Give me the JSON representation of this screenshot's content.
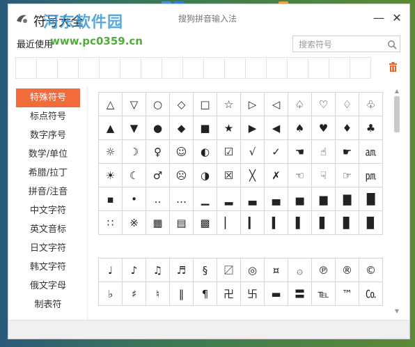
{
  "window": {
    "title": "符号大全",
    "center_title": "搜狗拼音输入法",
    "minimize_label": "—",
    "close_label": "✕"
  },
  "watermark": {
    "text": "河东软件园",
    "url": "www.pc0359.cn"
  },
  "recent": {
    "label": "最近使用",
    "cells": 17
  },
  "search": {
    "placeholder": "搜索符号",
    "value": ""
  },
  "sidebar": {
    "items": [
      {
        "label": "特殊符号",
        "active": true
      },
      {
        "label": "标点符号",
        "active": false
      },
      {
        "label": "数字序号",
        "active": false
      },
      {
        "label": "数学/单位",
        "active": false
      },
      {
        "label": "希腊/拉丁",
        "active": false
      },
      {
        "label": "拼音/注音",
        "active": false
      },
      {
        "label": "中文字符",
        "active": false
      },
      {
        "label": "英文音标",
        "active": false
      },
      {
        "label": "日文字符",
        "active": false
      },
      {
        "label": "韩文字符",
        "active": false
      },
      {
        "label": "俄文字母",
        "active": false
      },
      {
        "label": "制表符",
        "active": false
      }
    ]
  },
  "symbols_group1": [
    [
      "△",
      "▽",
      "○",
      "◇",
      "□",
      "☆",
      "▷",
      "◁",
      "♤",
      "♡",
      "♢",
      "♧"
    ],
    [
      "▲",
      "▼",
      "●",
      "◆",
      "■",
      "★",
      "▶",
      "◀",
      "♠",
      "♥",
      "♦",
      "♣"
    ],
    [
      "☼",
      "☽",
      "♀",
      "☺",
      "◐",
      "☑",
      "√",
      "✓",
      "☚",
      "☝",
      "☛",
      "㏂"
    ],
    [
      "☀",
      "☾",
      "♂",
      "☹",
      "◑",
      "☒",
      "╳",
      "✗",
      "☜",
      "☟",
      "☞",
      "㏘"
    ],
    [
      "▪",
      "•",
      "‥",
      "…",
      "▁",
      "▂",
      "▃",
      "▄",
      "▅",
      "▆",
      "▇",
      "█"
    ],
    [
      "∷",
      "※",
      "▦",
      "▤",
      "▩",
      "▏",
      "▎",
      "▍",
      "▌",
      "▋",
      "▊",
      "▉"
    ]
  ],
  "symbols_group2": [
    [
      "♩",
      "♪",
      "♫",
      "♬",
      "§",
      "〼",
      "◎",
      "¤",
      "۞",
      "℗",
      "®",
      "©"
    ],
    [
      "♭",
      "♯",
      "♮",
      "‖",
      "¶",
      "卍",
      "卐",
      "▬",
      "〓",
      "℡",
      "™",
      "㏇"
    ]
  ],
  "colors": {
    "accent": "#f26b3a",
    "trash": "#e8632f",
    "border": "#d6d6d6"
  }
}
